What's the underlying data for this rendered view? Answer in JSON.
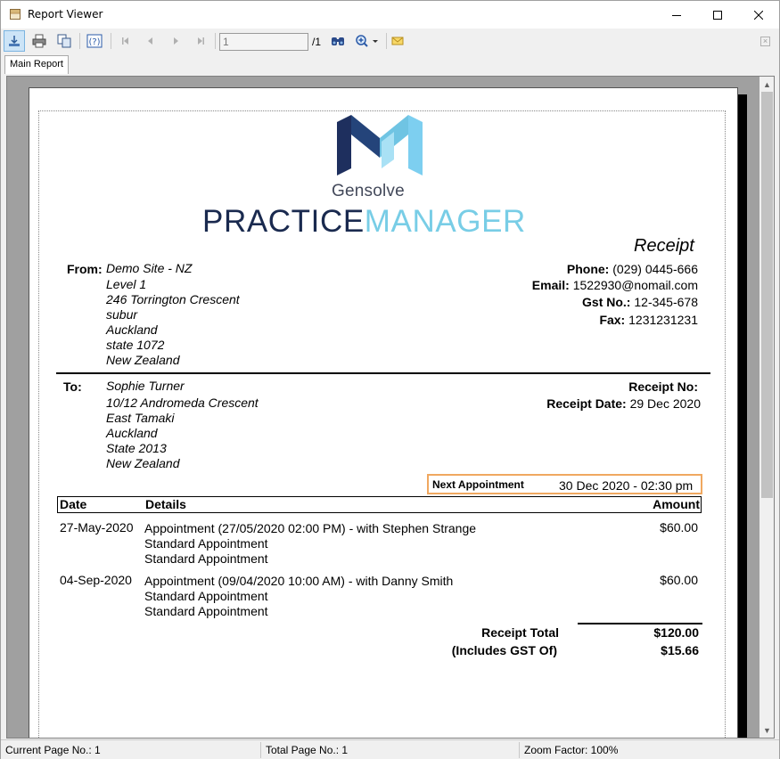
{
  "window": {
    "title": "Report Viewer"
  },
  "toolbar": {
    "page_number": "1",
    "page_total": "/1"
  },
  "tabs": [
    {
      "label": "Main Report"
    }
  ],
  "report": {
    "brand": {
      "top": "Gensolve",
      "part1": "PRACTICE",
      "part2": "MANAGER",
      "colors": {
        "navy": "#1a2a4f",
        "light_blue": "#78cde6"
      }
    },
    "title": "Receipt",
    "from": {
      "label": "From:",
      "lines": [
        "Demo Site - NZ",
        "Level 1",
        "246 Torrington Crescent",
        "subur",
        "Auckland",
        "state  1072",
        "New Zealand"
      ]
    },
    "contact": [
      {
        "label": "Phone:",
        "value": "(029) 0445-666"
      },
      {
        "label": "Email:",
        "value": "1522930@nomail.com"
      },
      {
        "label": "Gst No.:",
        "value": "12-345-678"
      },
      {
        "label": "Fax:",
        "value": "1231231231"
      }
    ],
    "to": {
      "label": "To:",
      "lines": [
        "Sophie Turner",
        "10/12 Andromeda Crescent",
        "East Tamaki",
        "Auckland",
        "State  2013",
        "New Zealand"
      ]
    },
    "receipt_no": {
      "label": "Receipt No:",
      "value": ""
    },
    "receipt_date": {
      "label": "Receipt Date:",
      "value": "29 Dec 2020"
    },
    "next_appointment": {
      "label": "Next Appointment",
      "value": "30 Dec 2020 - 02:30 pm",
      "border_color": "#f0a860"
    },
    "table": {
      "columns": [
        "Date",
        "Details",
        "Amount"
      ],
      "rows": [
        {
          "date": "27-May-2020",
          "details": [
            "Appointment (27/05/2020 02:00 PM) -  with Stephen Strange",
            "Standard Appointment",
            "Standard Appointment"
          ],
          "amount": "$60.00"
        },
        {
          "date": "04-Sep-2020",
          "details": [
            "Appointment (09/04/2020 10:00 AM) -  with Danny Smith",
            "Standard Appointment",
            "Standard Appointment"
          ],
          "amount": "$60.00"
        }
      ]
    },
    "totals": [
      {
        "label": "Receipt Total",
        "value": "$120.00"
      },
      {
        "label": "(Includes GST Of)",
        "value": "$15.66"
      }
    ]
  },
  "status": {
    "current_page": "Current Page No.: 1",
    "total_page": "Total Page No.: 1",
    "zoom": "Zoom Factor: 100%"
  },
  "icons": {
    "window": "report-viewer-icon",
    "toolbar": [
      "export-icon",
      "print-icon",
      "copy-icon",
      "help-icon",
      "first-page-icon",
      "prev-page-icon",
      "next-page-icon",
      "last-page-icon",
      "find-icon",
      "zoom-icon",
      "email-icon"
    ]
  }
}
